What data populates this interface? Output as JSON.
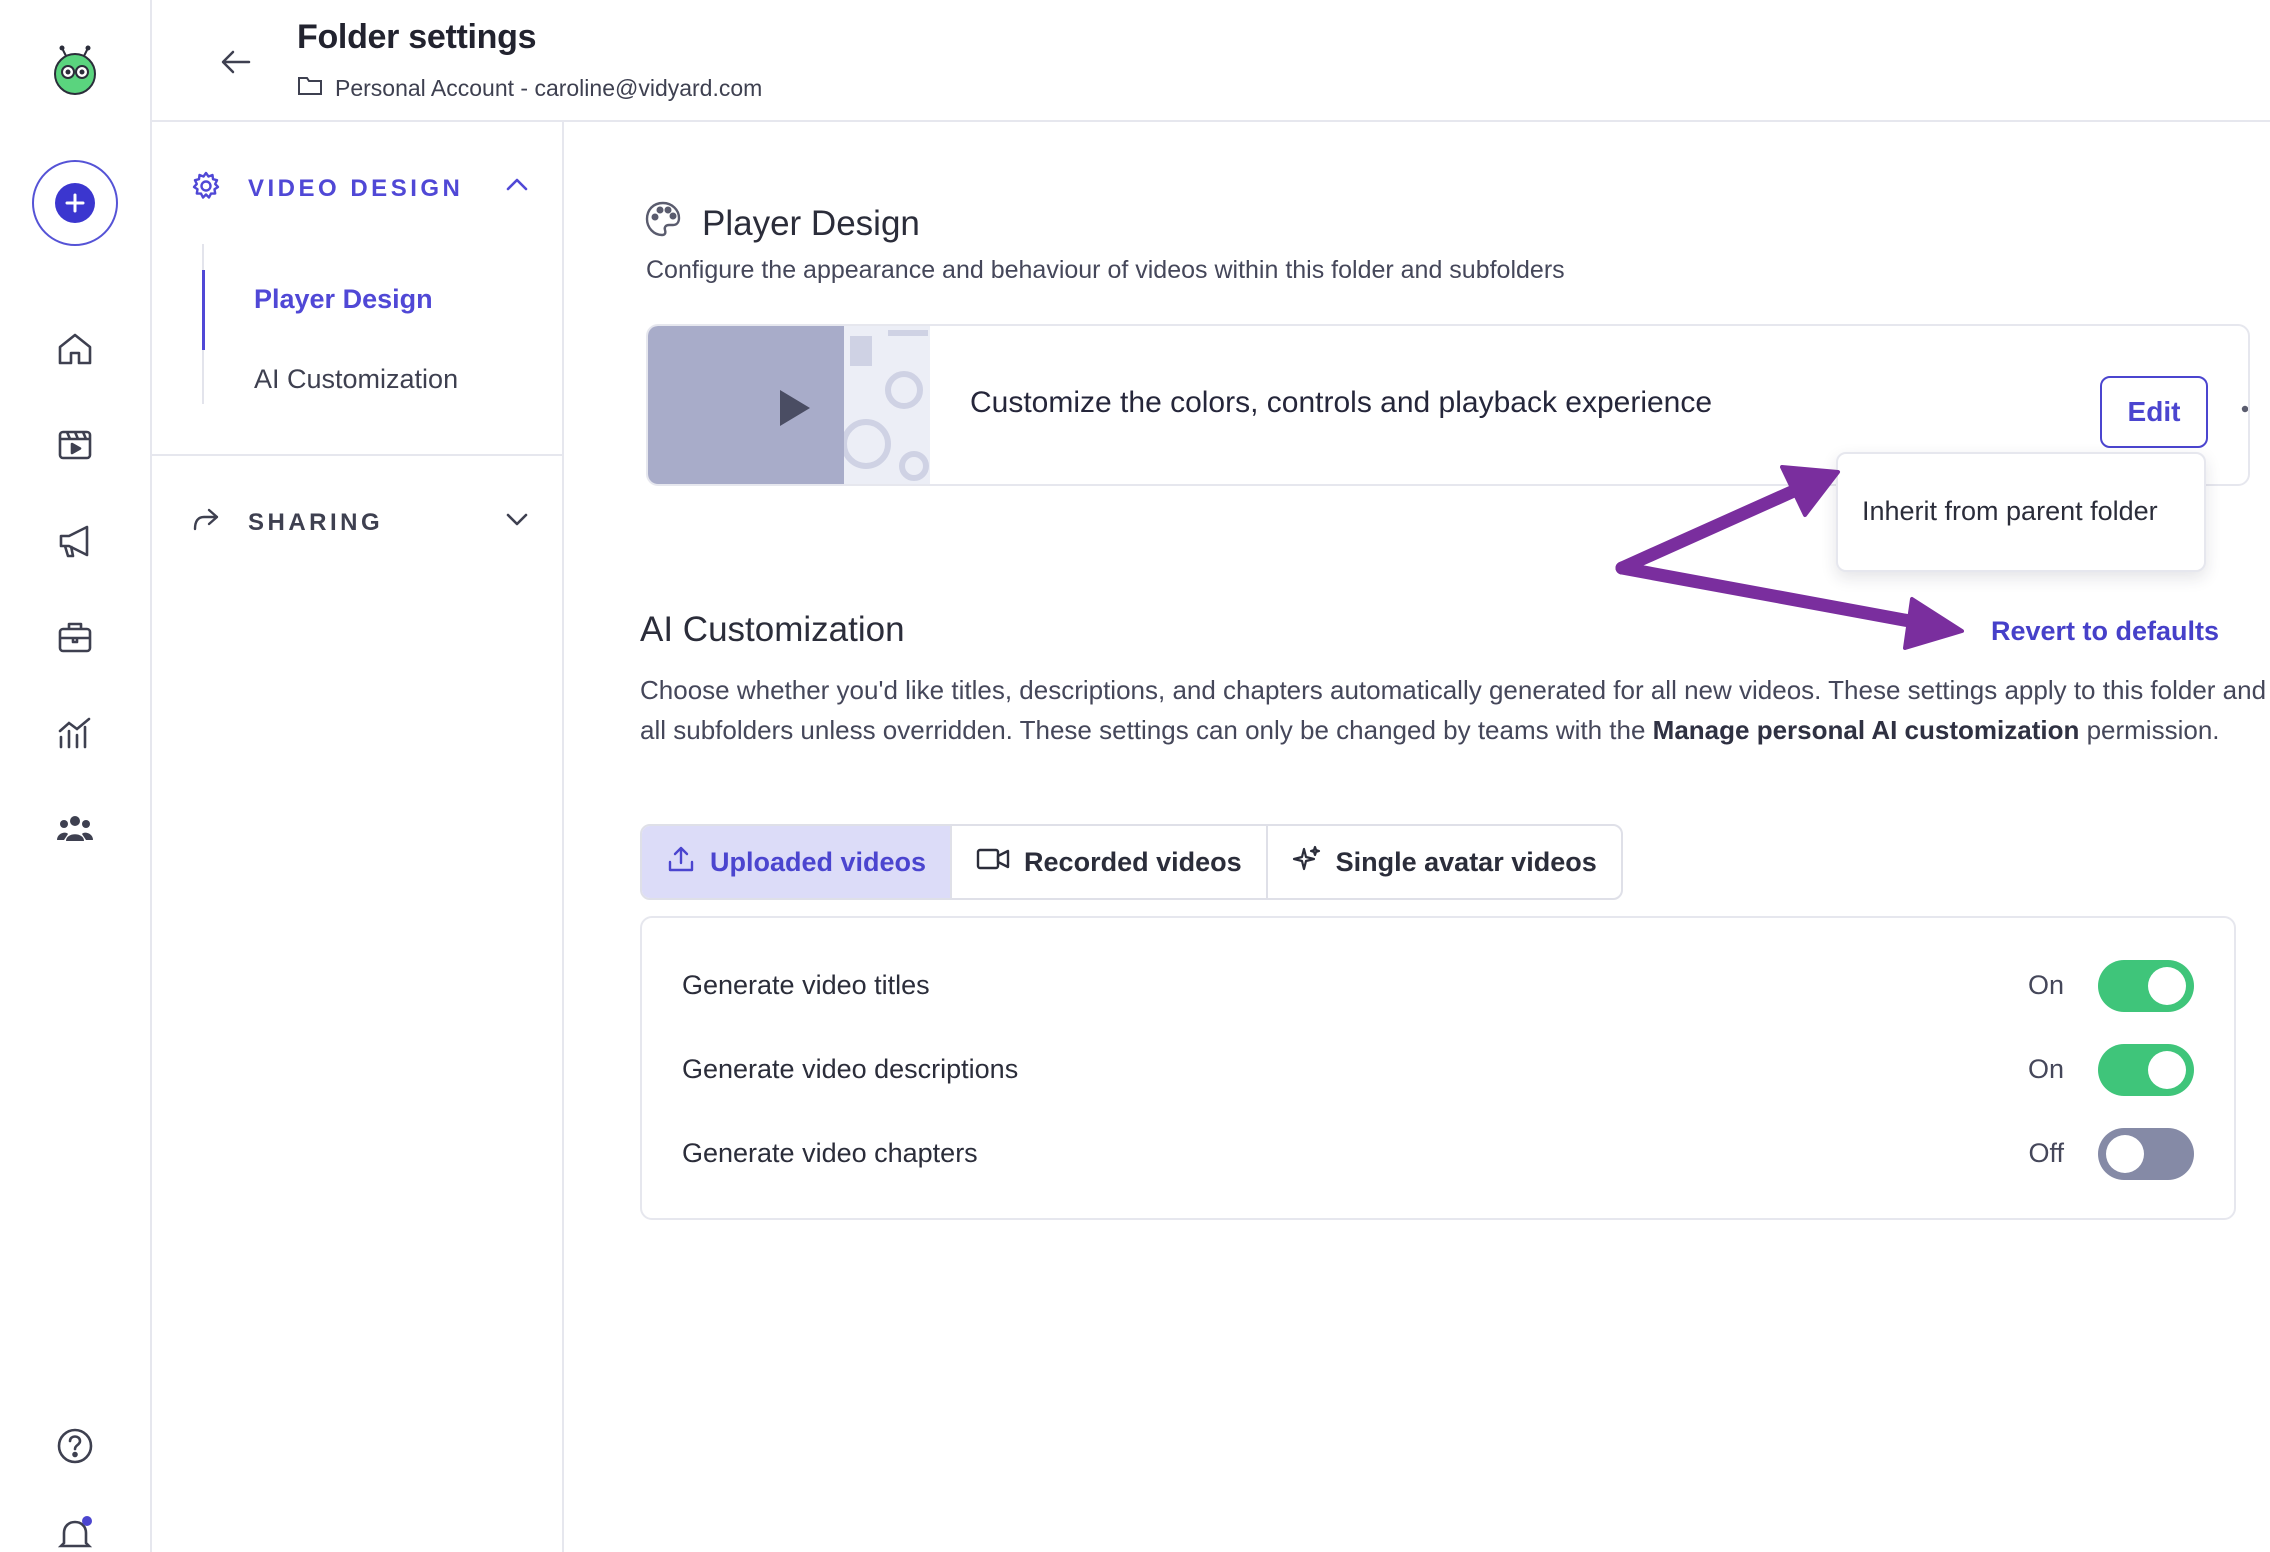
{
  "header": {
    "title": "Folder settings",
    "subtitle": "Personal Account - caroline@vidyard.com"
  },
  "subnav": {
    "video_design": {
      "label": "VIDEO DESIGN",
      "items": [
        {
          "label": "Player Design",
          "active": true
        },
        {
          "label": "AI Customization",
          "active": false
        }
      ]
    },
    "sharing": {
      "label": "SHARING"
    }
  },
  "player_design": {
    "title": "Player Design",
    "description": "Configure the appearance and behaviour of videos within this folder and subfolders",
    "card_text": "Customize the colors, controls and playback experience",
    "edit_label": "Edit",
    "menu_option": "Inherit from parent folder"
  },
  "ai_customization": {
    "title": "AI Customization",
    "revert_label": "Revert to defaults",
    "desc_part1": "Choose whether you'd like titles, descriptions, and chapters automatically generated for all new videos. These settings apply to this folder and all subfolders unless overridden. These settings can only be changed by teams with the ",
    "desc_bold": "Manage personal AI customization",
    "desc_part2": " permission.",
    "tabs": [
      {
        "label": "Uploaded videos",
        "active": true
      },
      {
        "label": "Recorded videos",
        "active": false
      },
      {
        "label": "Single avatar videos",
        "active": false
      }
    ],
    "settings": [
      {
        "label": "Generate video titles",
        "state": "On"
      },
      {
        "label": "Generate video descriptions",
        "state": "On"
      },
      {
        "label": "Generate video chapters",
        "state": "Off"
      }
    ]
  },
  "colors": {
    "accent": "#4b45cf",
    "toggle_on": "#3fc57a",
    "toggle_off": "#858aa6",
    "annotation_arrow": "#7a2e9e"
  }
}
